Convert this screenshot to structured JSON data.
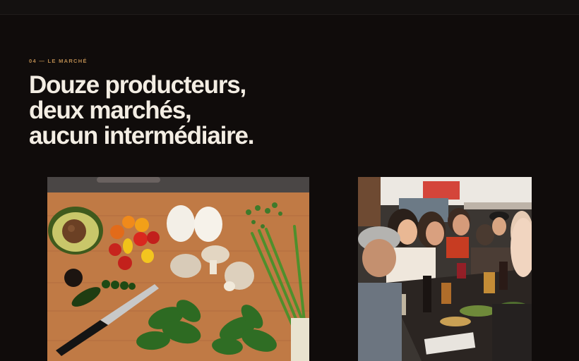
{
  "section": {
    "eyebrow": "04 — LE MARCHÉ",
    "headline_lines": [
      "Douze producteurs,",
      "deux marchés,",
      "aucun intermédiaire."
    ]
  },
  "colors": {
    "background": "#100c0b",
    "eyebrow": "#b7894f",
    "headline": "#f3ede3"
  },
  "images": [
    {
      "name": "produce-cutting-board-photo",
      "depicts": "avocado, tomatoes, eggs, mushrooms, spinach, green onions and a knife on a wooden board"
    },
    {
      "name": "communal-dinner-photo",
      "depicts": "people sharing a meal at a long table"
    }
  ]
}
